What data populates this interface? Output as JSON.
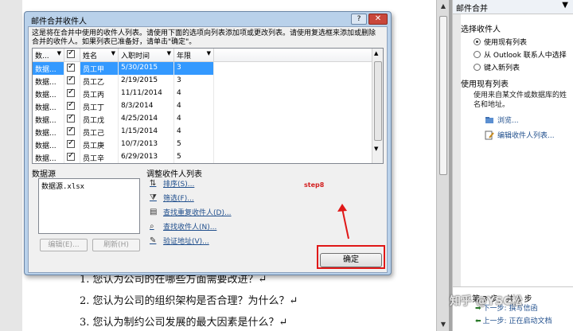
{
  "document": {
    "lines": [
      "1. 您认为公司的在哪些方面需要改进？↵",
      "2. 您认为公司的组织架构是否合理？为什么？↵",
      "3. 您认为制约公司发展的最大因素是什么？↵"
    ]
  },
  "task_pane": {
    "title": "邮件合并",
    "select_heading": "选择收件人",
    "options": [
      "使用现有列表",
      "从 Outlook 联系人中选择",
      "键入新列表"
    ],
    "use_existing_heading": "使用现有列表",
    "use_existing_desc": "使用来自某文件或数据库的姓名和地址。",
    "browse_link": "浏览...",
    "edit_link": "编辑收件人列表...",
    "step_text": "第 3 步，共 6 步",
    "next_link": "下一步: 撰写信函",
    "prev_link": "上一步: 正在启动文档"
  },
  "dialog": {
    "title": "邮件合并收件人",
    "help_label": "?",
    "close_label": "✕",
    "instructions": "这是将在合并中使用的收件人列表。请使用下面的选项向列表添加项或更改列表。请使用复选框来添加或删除合并的收件人。如果列表已准备好，请单击\"确定\"。",
    "columns": [
      "数...",
      "",
      "姓名",
      "入职时间",
      "年限"
    ],
    "rows": [
      {
        "source": "数据...",
        "checked": true,
        "name": "员工甲",
        "date": "5/30/2015",
        "years": "3"
      },
      {
        "source": "数据...",
        "checked": true,
        "name": "员工乙",
        "date": "2/19/2015",
        "years": "3"
      },
      {
        "source": "数据...",
        "checked": true,
        "name": "员工丙",
        "date": "11/11/2014",
        "years": "4"
      },
      {
        "source": "数据...",
        "checked": true,
        "name": "员工丁",
        "date": "8/3/2014",
        "years": "4"
      },
      {
        "source": "数据...",
        "checked": true,
        "name": "员工戊",
        "date": "4/25/2014",
        "years": "4"
      },
      {
        "source": "数据...",
        "checked": true,
        "name": "员工己",
        "date": "1/15/2014",
        "years": "4"
      },
      {
        "source": "数据...",
        "checked": true,
        "name": "员工庚",
        "date": "10/7/2013",
        "years": "5"
      },
      {
        "source": "数据...",
        "checked": true,
        "name": "员工辛",
        "date": "6/29/2013",
        "years": "5"
      }
    ],
    "data_source_label": "数据源",
    "data_source_item": "数据源.xlsx",
    "edit_button": "编辑(E)...",
    "refresh_button": "刷新(H)",
    "adjust_label": "调整收件人列表",
    "adjust_links": [
      "排序(S)...",
      "筛选(F)...",
      "查找重复收件人(D)...",
      "查找收件人(N)...",
      "验证地址(V)..."
    ],
    "ok_button": "确定",
    "annotation": "step8"
  },
  "watermark": "知乎 @YSC松",
  "colors": {
    "selection": "#3399ff",
    "annotation": "#e01818",
    "dialog_frame": "#b9d1ea"
  }
}
